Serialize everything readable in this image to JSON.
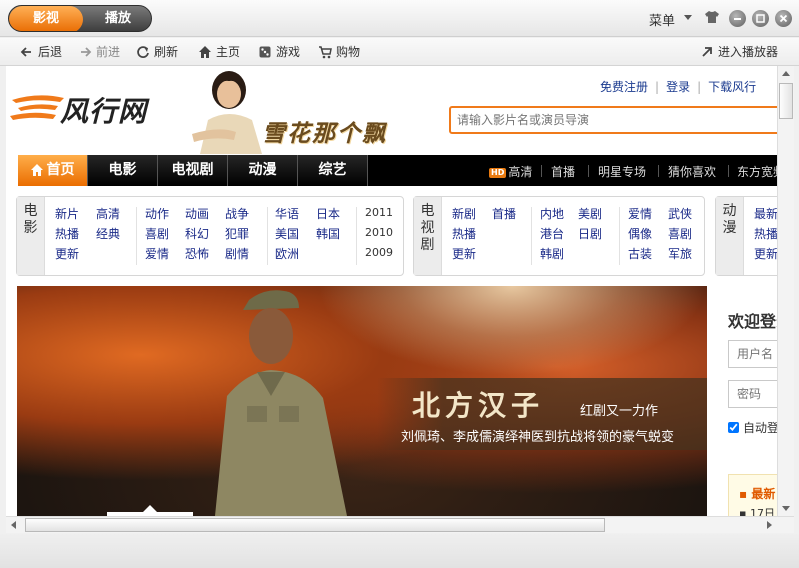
{
  "titlebar": {
    "tabs": [
      {
        "label": "影视",
        "active": true
      },
      {
        "label": "播放",
        "active": false
      }
    ],
    "menu_label": "菜单",
    "accent_color": "#f07a1a"
  },
  "navbar": {
    "back": "后退",
    "forward": "前进",
    "refresh": "刷新",
    "home": "主页",
    "games": "游戏",
    "shop": "购物",
    "enter_player": "进入播放器"
  },
  "page": {
    "logo_text": "风行网",
    "banner_title": "雪花那个飘",
    "top_links": [
      "免费注册",
      "登录",
      "下载风行"
    ],
    "search_placeholder": "请输入影片名或演员导演",
    "channels": [
      "首页",
      "电影",
      "电视剧",
      "动漫",
      "综艺"
    ],
    "sub_links": {
      "hd_badge": "HD",
      "hd": "高清",
      "premiere": "首播",
      "stars": "明星专场",
      "guess": "猜你喜欢",
      "east": "东方宽频"
    },
    "categories": {
      "movie": {
        "label": "电影",
        "col1": [
          "新片",
          "高清",
          "热播",
          "经典",
          "更新"
        ],
        "col2": [
          "动作",
          "动画",
          "战争",
          "喜剧",
          "科幻",
          "犯罪",
          "爱情",
          "恐怖",
          "剧情"
        ],
        "col3": [
          "华语",
          "日本",
          "美国",
          "韩国",
          "欧洲"
        ],
        "years": [
          "2011",
          "2010",
          "2009"
        ]
      },
      "tv": {
        "label": "电视剧",
        "col1": [
          "新剧",
          "首播",
          "热播",
          "更新"
        ],
        "col2": [
          "内地",
          "美剧",
          "港台",
          "日剧",
          "韩剧"
        ],
        "col3": [
          "爱情",
          "武侠",
          "偶像",
          "喜剧",
          "古装",
          "军旅"
        ]
      },
      "anime": {
        "label": "动漫",
        "col1": [
          "最新",
          "热播",
          "更新"
        ]
      }
    },
    "hero": {
      "title": "北方汉子",
      "subtitle": "红剧又一力作",
      "description": "刘佩琦、李成儒演绎神医到抗战将领的豪气蜕变"
    },
    "login": {
      "title": "欢迎登录",
      "username_placeholder": "用户名",
      "password_placeholder": "密码",
      "auto_login": "自动登录"
    },
    "news": {
      "item1": "最新",
      "item2": "17日"
    }
  }
}
